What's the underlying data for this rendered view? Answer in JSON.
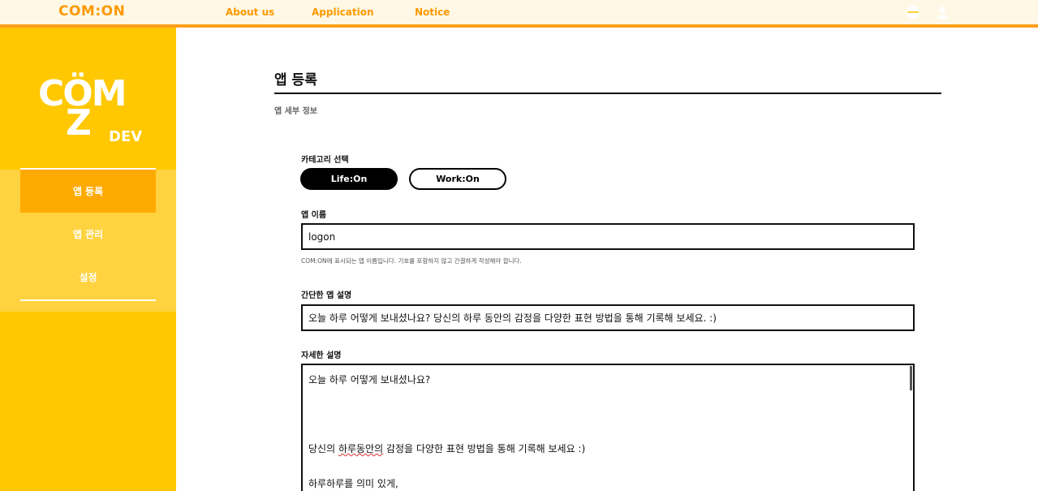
{
  "header": {
    "brand": "COM:ON",
    "nav": [
      "About us",
      "Application",
      "Notice"
    ],
    "icons": [
      "globe-icon",
      "user-icon"
    ]
  },
  "sidebar": {
    "logo": {
      "top": "CÖM",
      "z": "Z",
      "dev": "DEV"
    },
    "items": [
      {
        "label": "앱 등록",
        "active": true
      },
      {
        "label": "앱 관리",
        "active": false
      },
      {
        "label": "설정",
        "active": false
      }
    ]
  },
  "main": {
    "title": "앱 등록",
    "subtitle": "앱 세부 정보",
    "category": {
      "label": "카테고리 선택",
      "options": [
        "Life:On",
        "Work:On"
      ],
      "selected": "Life:On"
    },
    "app_name": {
      "label": "앱 이름",
      "value": "logon",
      "help": "COM:ON에 표시되는 앱 이름입니다. 기호를 포함하지 않고 간결하게 작성해야 합니다."
    },
    "short_desc": {
      "label": "간단한 앱 설명",
      "value": "오늘 하루 어떻게 보내셨나요? 당신의 하루 동안의 감정을 다양한 표현 방법을 통해 기록해 보세요. :)"
    },
    "long_desc": {
      "label": "자세한 설명",
      "lines": [
        "오늘 하루 어떻게 보내셨나요?",
        "당신의 ",
        "하루동안의",
        " 감정을 다양한 표현 방법을 통해 기록해 보세요 :)",
        "하루하루를 의미 있게,"
      ]
    }
  },
  "colors": {
    "accent": "#ff9900",
    "sidebar": "#ffc800",
    "sidebar_active": "#ffaa00"
  }
}
